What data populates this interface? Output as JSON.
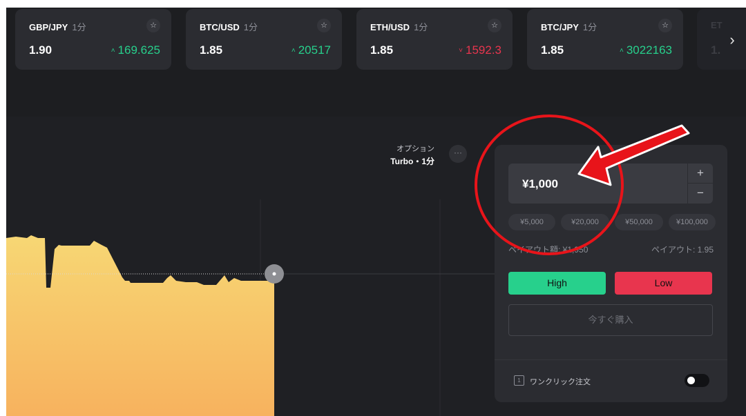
{
  "tickers": [
    {
      "pair": "GBP/JPY",
      "timeframe": "1分",
      "payout": "1.90",
      "price": "169.625",
      "direction": "up"
    },
    {
      "pair": "BTC/USD",
      "timeframe": "1分",
      "payout": "1.85",
      "price": "20517",
      "direction": "up"
    },
    {
      "pair": "ETH/USD",
      "timeframe": "1分",
      "payout": "1.85",
      "price": "1592.3",
      "direction": "down"
    },
    {
      "pair": "BTC/JPY",
      "timeframe": "1分",
      "payout": "1.85",
      "price": "3022163",
      "direction": "up"
    }
  ],
  "ticker_partial": {
    "pair": "ET",
    "payout": "1."
  },
  "icons": {
    "star": "☆",
    "up_arrow": "˄",
    "down_arrow": "˅",
    "next": "›",
    "more": "···",
    "oneclick": "1"
  },
  "option": {
    "label": "オプション",
    "value": "Turbo・1分"
  },
  "trade": {
    "amount": "¥1,000",
    "plus": "+",
    "minus": "−",
    "presets": [
      "¥5,000",
      "¥20,000",
      "¥50,000",
      "¥100,000"
    ],
    "payout_amount": "ペイアウト額: ¥1,950",
    "payout_rate": "ペイアウト: 1.95",
    "high": "High",
    "low": "Low",
    "buy_now": "今すぐ購入",
    "one_click": "ワンクリック注文",
    "one_click_enabled": false
  },
  "colors": {
    "up": "#27d08c",
    "down": "#e8354e",
    "area_top": "#f7d774",
    "area_bottom": "#f7b25e",
    "annotation": "#e8141a"
  }
}
